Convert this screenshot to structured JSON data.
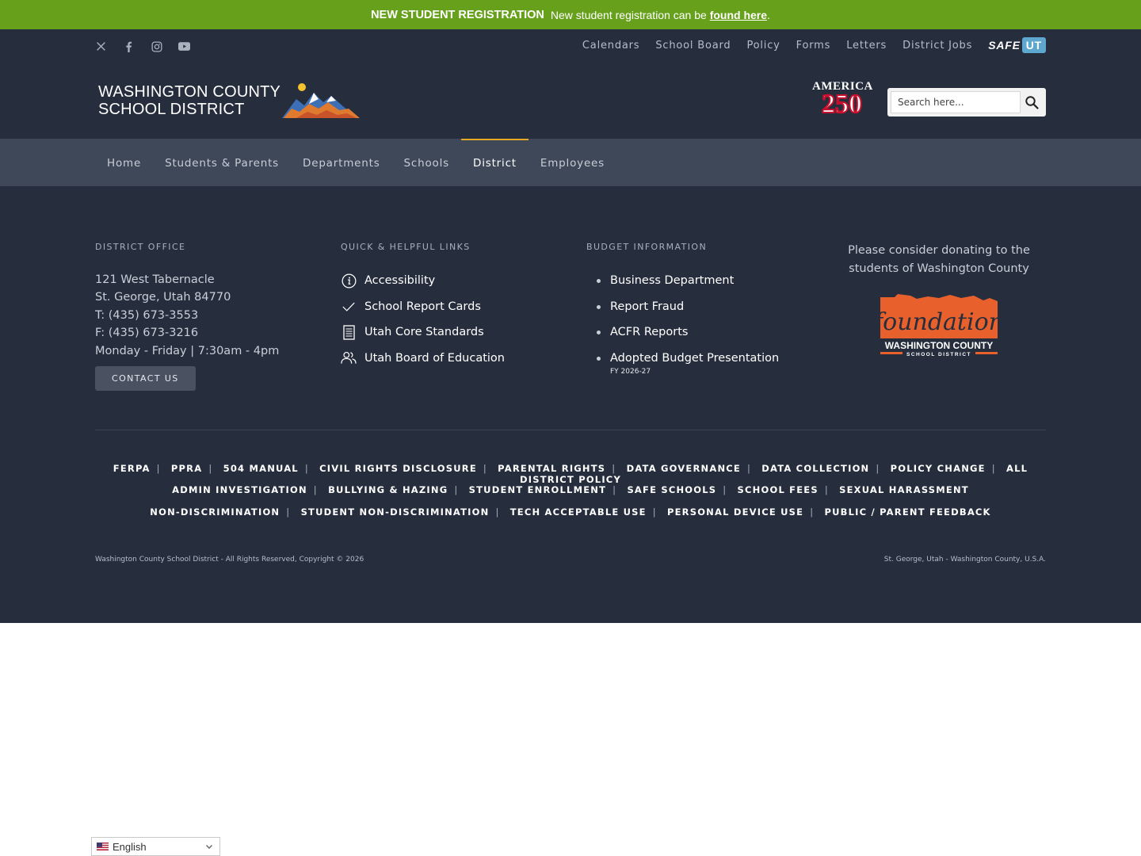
{
  "banner": {
    "title": "NEW STUDENT REGISTRATION",
    "text": "New student registration can be",
    "link": "found here",
    "end": "."
  },
  "social": [
    "x-icon",
    "facebook-icon",
    "instagram-icon",
    "youtube-icon"
  ],
  "toplinks": [
    "Calendars",
    "School Board",
    "Policy",
    "Forms",
    "Letters",
    "District Jobs"
  ],
  "safeut": {
    "safe": "SAFE",
    "ut": "UT"
  },
  "logo": {
    "line1": "WASHINGTON COUNTY",
    "line2": "SCHOOL DISTRICT"
  },
  "america250": {
    "word": "AMERICA",
    "num": "250"
  },
  "search": {
    "placeholder": "Search here..."
  },
  "nav": {
    "items": [
      "Home",
      "Students & Parents",
      "Departments",
      "Schools",
      "District",
      "Employees"
    ],
    "active": "District"
  },
  "footer": {
    "office": {
      "title": "DISTRICT OFFICE",
      "lines": [
        "121 West Tabernacle",
        "St. George, Utah 84770",
        "T: (435) 673-3553",
        "F: (435) 673-3216",
        "Monday - Friday | 7:30am - 4pm"
      ],
      "button": "CONTACT US"
    },
    "quick": {
      "title": "QUICK & HELPFUL LINKS",
      "items": [
        {
          "label": "Accessibility",
          "icon": "info-icon"
        },
        {
          "label": "School Report Cards",
          "icon": "check-icon"
        },
        {
          "label": "Utah Core Standards",
          "icon": "document-icon"
        },
        {
          "label": "Utah Board of Education",
          "icon": "users-icon"
        }
      ]
    },
    "budget": {
      "title": "BUDGET INFORMATION",
      "items": [
        "Business Department",
        "Report Fraud",
        "ACFR Reports",
        "Adopted Budget Presentation"
      ],
      "fy": "FY 2026-27"
    },
    "donate": {
      "text": "Please consider donating to the students of Washington County",
      "foundation_word": "foundation",
      "foundation_sub1": "WASHINGTON COUNTY",
      "foundation_sub2": "SCHOOL DISTRICT"
    },
    "policies": {
      "row1": [
        "FERPA",
        "PPRA",
        "504 MANUAL",
        "CIVIL RIGHTS DISCLOSURE",
        "PARENTAL RIGHTS",
        "DATA GOVERNANCE",
        "DATA COLLECTION",
        "POLICY CHANGE",
        "ALL DISTRICT POLICY"
      ],
      "row2": [
        "ADMIN INVESTIGATION",
        "BULLYING & HAZING",
        "STUDENT ENROLLMENT",
        "SAFE SCHOOLS",
        "SCHOOL FEES",
        "SEXUAL HARASSMENT"
      ],
      "row3": [
        "NON-DISCRIMINATION",
        "STUDENT NON-DISCRIMINATION",
        "TECH ACCEPTABLE USE",
        "PERSONAL DEVICE USE",
        "PUBLIC / PARENT FEEDBACK"
      ]
    },
    "copyright": "Washington County School District - All Rights Reserved, Copyright © 2026",
    "location": "St. George, Utah - Washington County, U.S.A."
  },
  "language": {
    "selected": "English"
  },
  "colors": {
    "banner": "#67a11c",
    "header": "#262e3d",
    "nav": "#3e4859",
    "active_accent": "#e5a823",
    "foundation": "#e8612c"
  }
}
